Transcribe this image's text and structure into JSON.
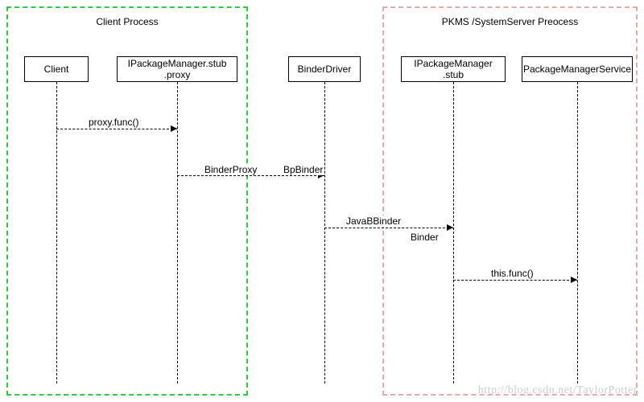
{
  "processes": {
    "client": {
      "title": "Client Process"
    },
    "server": {
      "title": "PKMS /SystemServer Preocess"
    }
  },
  "actors": {
    "client": {
      "label": "Client"
    },
    "proxy": {
      "label": "IPackageManager.stub\n.proxy"
    },
    "driver": {
      "label": "BinderDriver"
    },
    "stub": {
      "label": "IPackageManager\n.stub"
    },
    "pms": {
      "label": "PackageManagerService"
    }
  },
  "messages": {
    "m1": {
      "text": "proxy.func()"
    },
    "m2a": {
      "text": "BinderProxy"
    },
    "m2b": {
      "text": "BpBinder"
    },
    "m3a": {
      "text": "JavaBBinder"
    },
    "m3b": {
      "text": "Binder"
    },
    "m4": {
      "text": "this.func()"
    }
  },
  "watermark": "http://blog.csdn.net/TaylorPotter",
  "chart_data": {
    "type": "sequence-diagram",
    "processes": [
      {
        "name": "Client Process",
        "actors": [
          "Client",
          "IPackageManager.stub.proxy"
        ]
      },
      {
        "name": "PKMS /SystemServer Preocess",
        "actors": [
          "IPackageManager.stub",
          "PackageManagerService"
        ]
      }
    ],
    "actors": [
      "Client",
      "IPackageManager.stub.proxy",
      "BinderDriver",
      "IPackageManager.stub",
      "PackageManagerService"
    ],
    "messages": [
      {
        "from": "Client",
        "to": "IPackageManager.stub.proxy",
        "label": "proxy.func()"
      },
      {
        "from": "IPackageManager.stub.proxy",
        "to": "BinderDriver",
        "label_left": "BinderProxy",
        "label_right": "BpBinder"
      },
      {
        "from": "BinderDriver",
        "to": "IPackageManager.stub",
        "label_left": "JavaBBinder",
        "label_right": "Binder"
      },
      {
        "from": "IPackageManager.stub",
        "to": "PackageManagerService",
        "label": "this.func()"
      }
    ]
  }
}
